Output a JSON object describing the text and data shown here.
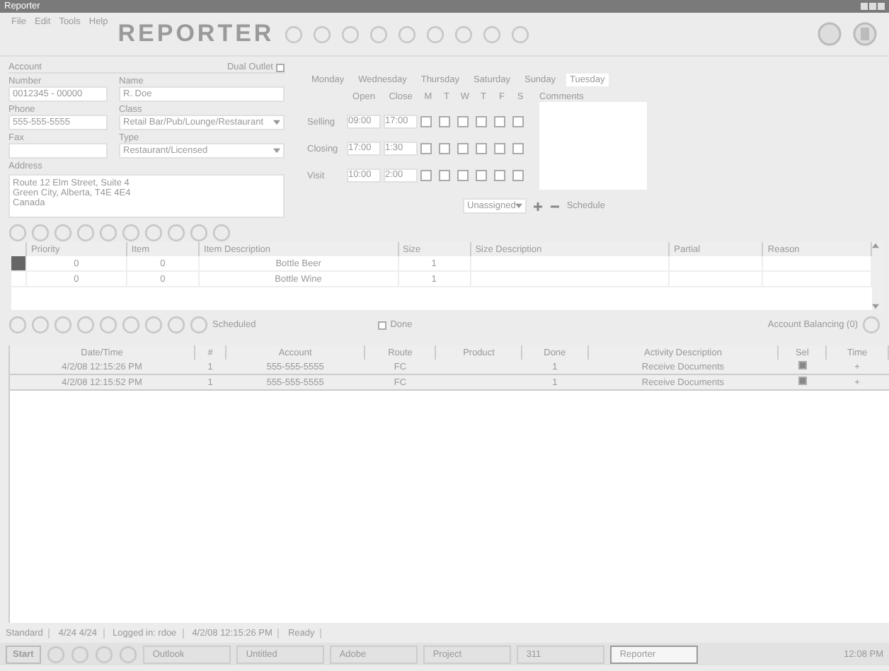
{
  "window": {
    "title": "Reporter"
  },
  "menu": [
    "File",
    "Edit",
    "Tools",
    "Help"
  ],
  "logo": "REPORTER",
  "account": {
    "heading": "Account",
    "dual_outlet": {
      "label": "Dual Outlet",
      "checked": false
    },
    "fields": [
      {
        "label": "Number",
        "value": "0012345 - 00000",
        "kind": "text"
      },
      {
        "label": "Name",
        "value": "R. Doe",
        "kind": "text"
      },
      {
        "label": "Phone",
        "value": "555-555-5555",
        "kind": "text"
      },
      {
        "label": "Class",
        "value": "Retail Bar/Pub/Lounge/Restaurant",
        "kind": "select"
      },
      {
        "label": "Fax",
        "kind": "text"
      },
      {
        "label": "Type",
        "value": "Restaurant/Licensed",
        "kind": "select"
      }
    ],
    "address": {
      "label": "Address",
      "lines": [
        "Route 12 Elm Street, Suite 4",
        "Green City, Alberta, T4E 4E4",
        "Canada"
      ]
    }
  },
  "schedule": {
    "tabs": [
      {
        "label": "Monday",
        "selected": false
      },
      {
        "label": "Wednesday",
        "selected": false
      },
      {
        "label": "Thursday",
        "selected": false
      },
      {
        "label": "Saturday",
        "selected": false
      },
      {
        "label": "Sunday",
        "selected": false
      },
      {
        "label": "Tuesday",
        "selected": true
      }
    ],
    "columns": [
      "Open",
      "Close"
    ],
    "days": [
      "M",
      "T",
      "W",
      "T",
      "F",
      "S"
    ],
    "rows": [
      {
        "label": "Selling",
        "open": "09:00",
        "close": "17:00",
        "days": [
          false,
          false,
          false,
          false,
          false,
          false
        ]
      },
      {
        "label": "Closing",
        "open": "17:00",
        "close": "1:30",
        "days": [
          false,
          false,
          false,
          false,
          false,
          false
        ]
      },
      {
        "label": "Visit",
        "open": "10:00",
        "close": "2:00",
        "days": [
          false,
          false,
          false,
          false,
          false,
          false
        ]
      }
    ],
    "comments_label": "Comments",
    "assigned": "Unassigned",
    "schedule_label": "Schedule"
  },
  "items": {
    "columns": [
      "Priority",
      "Item",
      "Item Description",
      "Size",
      "Size Description",
      "Partial",
      "Reason"
    ],
    "rows": [
      {
        "selected": true,
        "cells": [
          "0",
          "0",
          "Bottle Beer",
          "1",
          "",
          "",
          ""
        ]
      },
      {
        "selected": false,
        "cells": [
          "0",
          "0",
          "Bottle Wine",
          "1",
          "",
          "",
          ""
        ]
      }
    ]
  },
  "actions": {
    "scheduled_label": "Scheduled",
    "done": {
      "label": "Done",
      "checked": false
    },
    "balancing": "Account Balancing (0)"
  },
  "log": {
    "columns": [
      "Date/Time",
      "#",
      "Account",
      "Route",
      "Product",
      "Done",
      "Activity Description",
      "Sel",
      "Time"
    ],
    "rows": [
      {
        "cells": [
          "4/2/08 12:15:26 PM",
          "1",
          "555-555-5555",
          "FC",
          "",
          "1",
          "Receive Documents"
        ],
        "checked": true,
        "time": "+"
      },
      {
        "cells": [
          "4/2/08 12:15:52 PM",
          "1",
          "555-555-5555",
          "FC",
          "",
          "1",
          "Receive Documents"
        ],
        "checked": true,
        "time": "+"
      }
    ]
  },
  "status_bar": [
    "Standard",
    "4/24 4/24",
    "Logged in: rdoe",
    "4/2/08 12:15:26 PM",
    "Ready"
  ],
  "taskbar": {
    "start": "Start",
    "tasks": [
      {
        "label": "Outlook",
        "selected": false
      },
      {
        "label": "Untitled",
        "selected": false
      },
      {
        "label": "Adobe",
        "selected": false
      },
      {
        "label": "Project",
        "selected": false
      },
      {
        "label": "311",
        "selected": false
      },
      {
        "label": "Reporter",
        "selected": true
      }
    ],
    "clock": "12:08 PM"
  }
}
